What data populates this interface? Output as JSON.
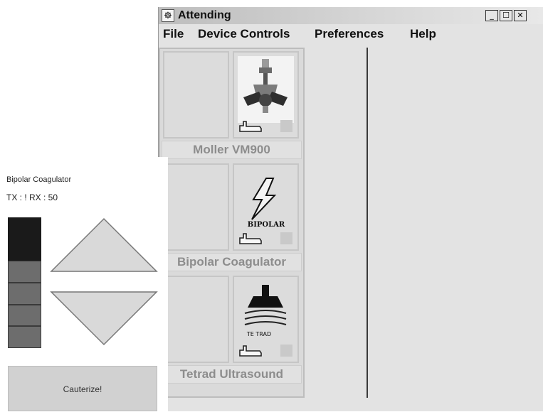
{
  "window": {
    "title": "Attending",
    "app_icon_glyph": "☸",
    "minimize_glyph": "_",
    "maximize_glyph": "☐",
    "close_glyph": "✕"
  },
  "menu": {
    "items": [
      "File",
      "Device Controls",
      "Preferences",
      "Help"
    ]
  },
  "devices": [
    {
      "name": "Moller VM900",
      "image": "microscope-image",
      "tile_label": ""
    },
    {
      "name": "Bipolar Coagulator",
      "image": "bipolar-image",
      "tile_label": "BIPOLAR"
    },
    {
      "name": "Tetrad Ultrasound",
      "image": "ultrasound-image",
      "tile_label": "TE TRAD"
    }
  ],
  "control_panel": {
    "title": "Bipolar Coagulator",
    "status": "TX : !    RX : 50",
    "level": {
      "filled_segments": 2,
      "total_segments": 6
    },
    "cauterize_label": "Cauterize!"
  },
  "colors": {
    "panel_background": "#e3e3e3",
    "device_label_text": "#8d8d8d",
    "level_dark": "#1a1a1a",
    "level_medium": "#6d6d6d",
    "arrow_fill": "#d9d9d9"
  }
}
